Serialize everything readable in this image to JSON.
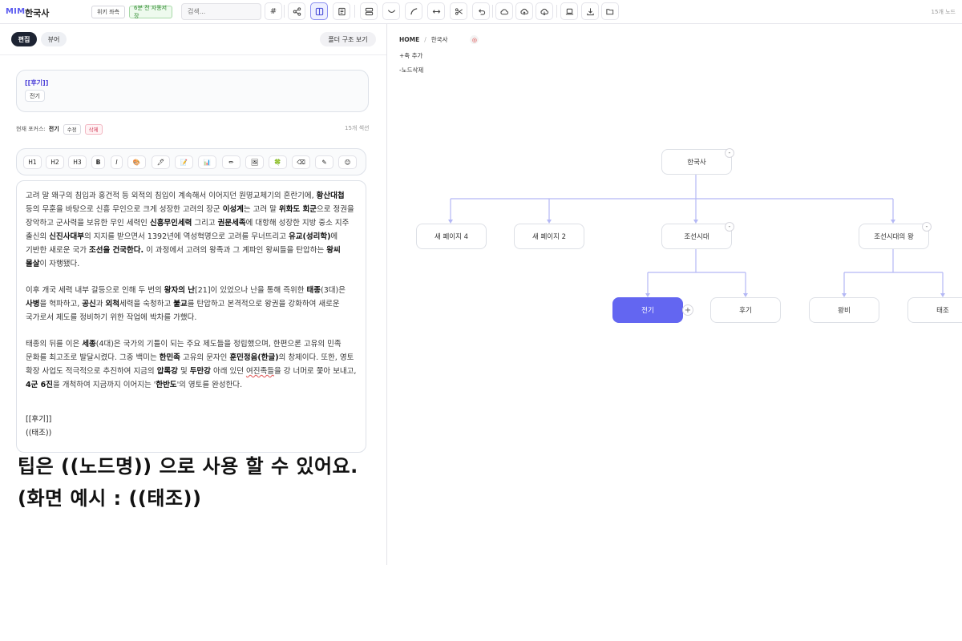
{
  "header": {
    "logo": "MIM",
    "title": "한국사",
    "wiki_label": "위키 좌측",
    "autosave_label": "6분 전 자동저장",
    "search_placeholder": "검색...",
    "hash_label": "#",
    "count": "15개 노드"
  },
  "toolbar_icons": [
    "share-icon",
    "split-view-icon",
    "document-icon",
    "layout-icon",
    "curve-down-icon",
    "curve-icon",
    "arrows-horizontal-icon",
    "scissors-icon",
    "undo-icon",
    "cloud-icon",
    "cloud-upload-icon",
    "cloud-download-icon",
    "laptop-icon",
    "download-icon",
    "folder-open-icon"
  ],
  "left": {
    "tab_edit": "편집",
    "tab_view": "뷰어",
    "folder_button": "폴더 구조 보기",
    "linkbox_title": "[[후기]]",
    "linkbox_chip": "전기",
    "focus_label": "현재 포커스:",
    "focus_name": "전기",
    "edit_button": "수정",
    "delete_button": "삭제",
    "section_count": "15개 섹션"
  },
  "format_buttons": [
    "H1",
    "H2",
    "H3",
    "B",
    "I",
    "🎨",
    "🖊",
    "📝",
    "📊",
    "✏",
    "🖼",
    "🍀",
    "⌫",
    "✎",
    "😊"
  ],
  "editor": {
    "p1": [
      {
        "t": "고려 말 왜구의 침입과 홍건적 등 외적의 침입이 계속해서 이어지던 원명교체기의 혼란기에, "
      },
      {
        "t": "황산대첩",
        "b": true
      },
      {
        "t": " 등의 무훈을 바탕으로 신흥 무인으로 크게 성장한 고려의 장군 "
      },
      {
        "t": "이성계",
        "b": true
      },
      {
        "t": "는 고려 말 "
      },
      {
        "t": "위화도 회군",
        "b": true
      },
      {
        "t": "으로 정권을 장악하고 군사력을 보유한 무인 세력인 "
      },
      {
        "t": "신흥무인세력",
        "b": true
      },
      {
        "t": " 그리고 "
      },
      {
        "t": "권문세족",
        "b": true
      },
      {
        "t": "에 대항해 성장한 지방 중소 지주 출신의 "
      },
      {
        "t": "신진사대부",
        "b": true
      },
      {
        "t": "의 지지를 받으면서 1392년에 역성혁명으로 고려를 무너뜨리고 "
      },
      {
        "t": "유교(성리학)",
        "b": true
      },
      {
        "t": "에 기반한 새로운 국가 "
      },
      {
        "t": "조선을 건국한다.",
        "b": true
      },
      {
        "t": " 이 과정에서 고려의 왕족과 그 계파인 왕씨들을 탄압하는 "
      },
      {
        "t": "왕씨 몰살",
        "b": true
      },
      {
        "t": "이 자행됐다."
      }
    ],
    "p2": [
      {
        "t": "이후 개국 세력 내부 갈등으로 인해 두 번의 "
      },
      {
        "t": "왕자의 난",
        "b": true
      },
      {
        "t": "[21]이 있었으나 난을 통해 즉위한 "
      },
      {
        "t": "태종",
        "b": true
      },
      {
        "t": "(3대)은 "
      },
      {
        "t": "사병",
        "b": true
      },
      {
        "t": "을 혁파하고, "
      },
      {
        "t": "공신",
        "b": true
      },
      {
        "t": "과 "
      },
      {
        "t": "외척",
        "b": true
      },
      {
        "t": "세력을 숙청하고 "
      },
      {
        "t": "불교",
        "b": true
      },
      {
        "t": "를 탄압하고 본격적으로 왕권을 강화하여 새로운 국가로서 제도를 정비하기 위한 작업에 박차를 가했다."
      }
    ],
    "p3": [
      {
        "t": "태종의 뒤를 이은 "
      },
      {
        "t": "세종",
        "b": true
      },
      {
        "t": "(4대)은 국가의 기틀이 되는 주요 제도들을 정립했으며, 한편으론 고유의 민족 문화를 최고조로 발달시켰다. 그중 백미는 "
      },
      {
        "t": "한민족",
        "b": true
      },
      {
        "t": " 고유의 문자인 "
      },
      {
        "t": "훈민정음(한글)",
        "b": true
      },
      {
        "t": "의 창제이다. 또한, 영토 확장 사업도 적극적으로 추진하여 지금의 "
      },
      {
        "t": "압록강",
        "b": true
      },
      {
        "t": " 및 "
      },
      {
        "t": "두만강",
        "b": true
      },
      {
        "t": " 아래 있던 "
      },
      {
        "t": "여진족들",
        "w": true
      },
      {
        "t": "을 강 너머로 쫓아 보내고, "
      },
      {
        "t": "4군 6진",
        "b": true
      },
      {
        "t": "을 개척하여 지금까지 이어지는 '"
      },
      {
        "t": "한반도",
        "b": true
      },
      {
        "t": "'의 영토를 완성한다."
      }
    ],
    "tag1": "[[후기]]",
    "tag2": "((태조))"
  },
  "overlay": {
    "line1": "팁은 ((노드명)) 으로 사용 할 수 있어요.",
    "line2": "(화면 예시 : ((태조))"
  },
  "right": {
    "crumb_home": "HOME",
    "crumb_sep": "/",
    "crumb_current": "한국사",
    "add_child": "+축 추가",
    "delete_node": "-노드삭제",
    "nodes": {
      "root": "한국사",
      "n1": "새 페이지 4",
      "n2": "새 페이지 2",
      "n3": "조선시대",
      "n4": "조선시대의 왕",
      "n5": "전기",
      "n6": "후기",
      "n7": "왕비",
      "n8": "태조"
    }
  },
  "colors": {
    "accent": "#6366f1",
    "edge": "#b4b8f5",
    "dark_tab": "#1d2433"
  }
}
